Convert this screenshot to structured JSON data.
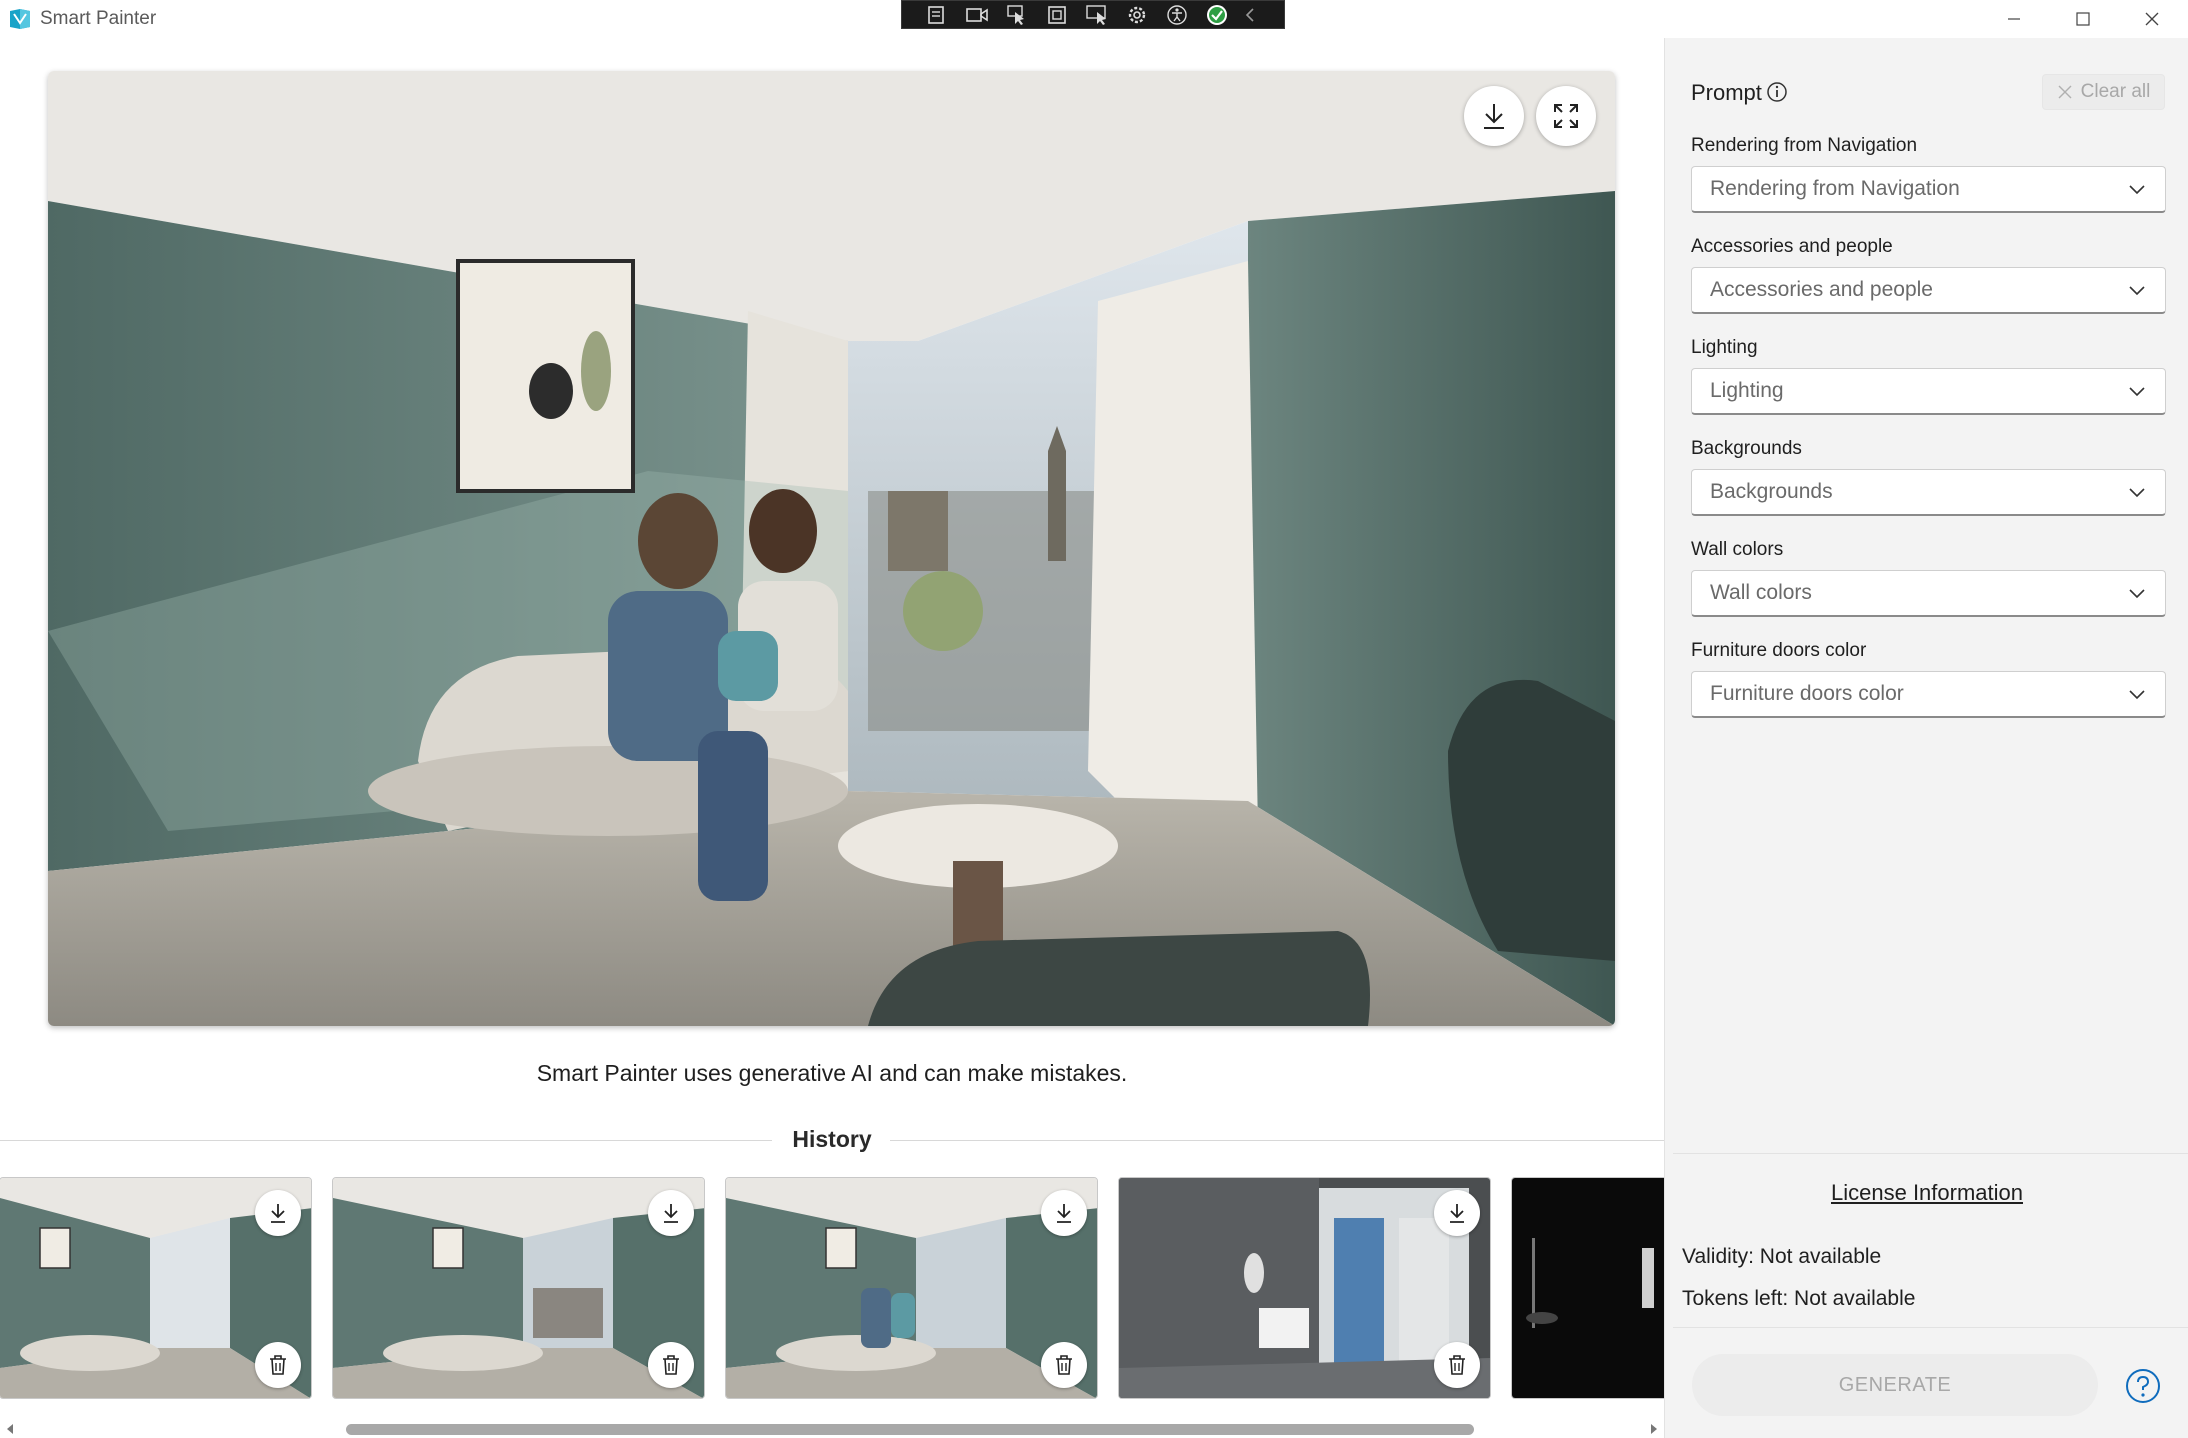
{
  "app": {
    "title": "Smart Painter"
  },
  "main": {
    "disclaimer": "Smart Painter uses generative AI and can make mistakes.",
    "history_title": "History",
    "thumbnails": [
      {
        "scene": "living-room-empty"
      },
      {
        "scene": "living-room-city-view"
      },
      {
        "scene": "living-room-family"
      },
      {
        "scene": "bathroom-grey"
      },
      {
        "scene": "bathroom-dark"
      }
    ]
  },
  "panel": {
    "prompt_label": "Prompt",
    "clear_all": "Clear all",
    "fields": [
      {
        "label": "Rendering from Navigation",
        "value": "Rendering from Navigation"
      },
      {
        "label": "Accessories and people",
        "value": "Accessories and people"
      },
      {
        "label": "Lighting",
        "value": "Lighting"
      },
      {
        "label": "Backgrounds",
        "value": "Backgrounds"
      },
      {
        "label": "Wall colors",
        "value": "Wall colors"
      },
      {
        "label": "Furniture doors color",
        "value": "Furniture doors color"
      }
    ],
    "license_link": "License Information",
    "validity": "Validity: Not available",
    "tokens": "Tokens left: Not available",
    "generate": "GENERATE"
  },
  "colors": {
    "accent": "#0f6cbd",
    "logo": "#1aa3c8",
    "wall": "#6f8a83"
  }
}
